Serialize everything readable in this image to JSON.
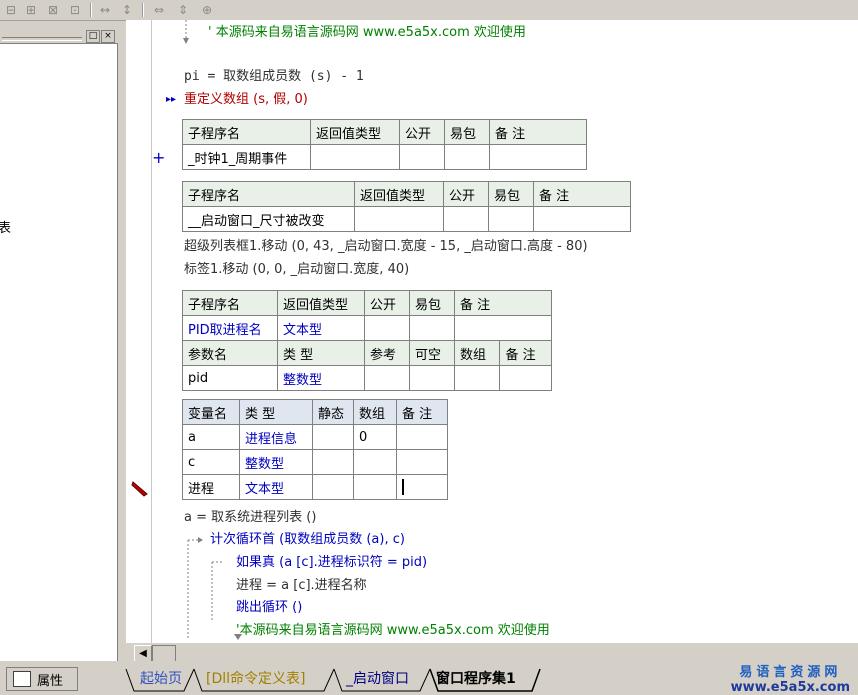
{
  "left_panel": {
    "partial_text": "表",
    "btn_max": "□",
    "btn_close": "×"
  },
  "code": {
    "l1": "' 本源码来自易语言源码网 www.e5a5x.com  欢迎使用",
    "l2": "pi = 取数组成员数 (s) - 1",
    "l3": "重定义数组 (s, 假, 0)",
    "t1": {
      "h": [
        "子程序名",
        "返回值类型",
        "公开",
        "易包",
        "备 注"
      ],
      "r": [
        "_时钟1_周期事件",
        "",
        "",
        "",
        ""
      ]
    },
    "t2": {
      "h": [
        "子程序名",
        "返回值类型",
        "公开",
        "易包",
        "备 注"
      ],
      "r": [
        "__启动窗口_尺寸被改变",
        "",
        "",
        "",
        ""
      ]
    },
    "l4": "超级列表框1.移动 (0, 43, _启动窗口.宽度 - 15, _启动窗口.高度 - 80)",
    "l5": "标签1.移动 (0, 0, _启动窗口.宽度, 40)",
    "t3": {
      "h": [
        "子程序名",
        "返回值类型",
        "公开",
        "易包",
        "备 注"
      ],
      "r": [
        "PID取进程名",
        "文本型",
        "",
        "",
        ""
      ],
      "ph": [
        "参数名",
        "类 型",
        "参考",
        "可空",
        "数组",
        "备 注"
      ],
      "pr": [
        "pid",
        "整数型",
        "",
        "",
        "",
        ""
      ]
    },
    "t4": {
      "h": [
        "变量名",
        "类 型",
        "静态",
        "数组",
        "备 注"
      ],
      "rows": [
        [
          "a",
          "进程信息",
          "",
          "0",
          ""
        ],
        [
          "c",
          "整数型",
          "",
          "",
          ""
        ],
        [
          "进程",
          "文本型",
          "",
          "",
          ""
        ]
      ]
    },
    "l6": "a = 取系统进程列表 ()",
    "l7": "计次循环首 (取数组成员数 (a), c)",
    "l8": "如果真 (a [c].进程标识符 = pid)",
    "l9": "进程 = a [c].进程名称",
    "l10": "跳出循环 ()",
    "l11": "'本源码来自易语言源码网 www.e5a5x.com  欢迎使用",
    "gutter_plus": "+",
    "gutter_arrow": "▸▸"
  },
  "tabs": {
    "props": "属性",
    "t1": "起始页",
    "t2": "[Dll命令定义表]",
    "t3": "_启动窗口",
    "t4": "窗口程序集1"
  },
  "logo": {
    "line1": "易语言资源网",
    "line2": "www.e5a5x.com"
  }
}
